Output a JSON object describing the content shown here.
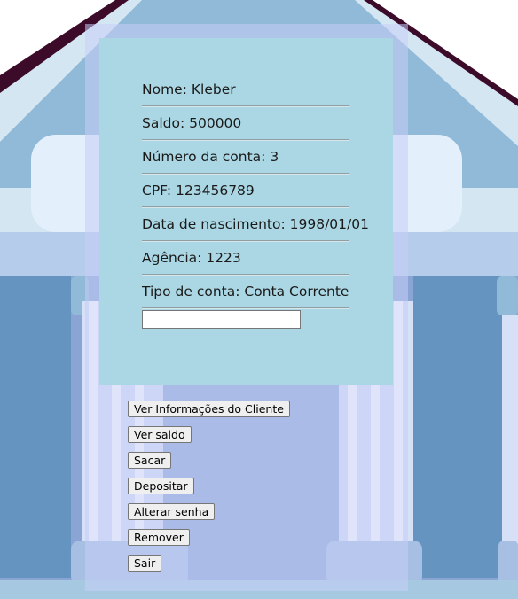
{
  "client_info": {
    "nome": "Nome: Kleber",
    "saldo": "Saldo: 500000",
    "numero_conta": "Número da conta: 3",
    "cpf": "CPF: 123456789",
    "data_nascimento": "Data de nascimento: 1998/01/01",
    "agencia": "Agência: 1223",
    "tipo_conta": "Tipo de conta: Conta Corrente"
  },
  "input": {
    "value": "",
    "placeholder": ""
  },
  "actions": {
    "ver_informacoes": "Ver Informações do Cliente",
    "ver_saldo": "Ver saldo",
    "sacar": "Sacar",
    "depositar": "Depositar",
    "alterar_senha": "Alterar senha",
    "remover": "Remover",
    "sair": "Sair"
  },
  "colors": {
    "card": "#abd7e4",
    "roof_outline": "#3d0b2a",
    "wall": "#8aa4d4",
    "column": "#d6e0f7",
    "pillar_blue": "#6594c0"
  }
}
